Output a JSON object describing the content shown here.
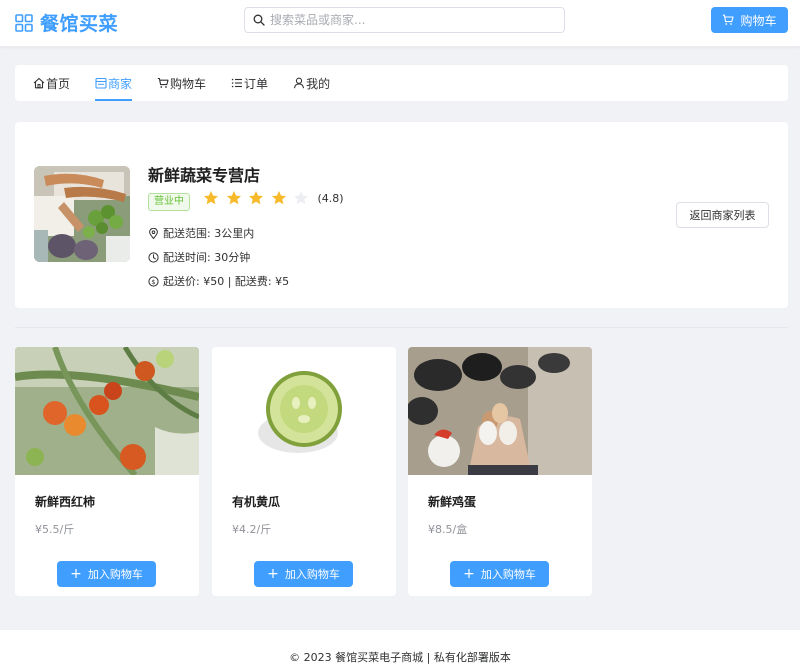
{
  "app": {
    "title": "餐馆买菜",
    "brand_color": "#409eff"
  },
  "header": {
    "search_placeholder": "搜索菜品或商家...",
    "cart_label": "购物车"
  },
  "nav": {
    "items": [
      {
        "label": "首页",
        "icon": "home-icon",
        "active": false
      },
      {
        "label": "商家",
        "icon": "shop-icon",
        "active": true
      },
      {
        "label": "购物车",
        "icon": "cart-icon",
        "active": false
      },
      {
        "label": "订单",
        "icon": "list-icon",
        "active": false
      },
      {
        "label": "我的",
        "icon": "user-icon",
        "active": false
      }
    ]
  },
  "store": {
    "name": "新鲜蔬菜专营店",
    "status": "营业中",
    "rating": 4.8,
    "rating_text": "(4.8)",
    "delivery_range": "配送范围: 3公里内",
    "delivery_time": "配送时间: 30分钟",
    "fees": "起送价: ¥50 | 配送费: ¥5",
    "back_label": "返回商家列表"
  },
  "products": [
    {
      "name": "新鲜西红柿",
      "price": "¥5.5/斤",
      "add_label": "加入购物车"
    },
    {
      "name": "有机黄瓜",
      "price": "¥4.2/斤",
      "add_label": "加入购物车"
    },
    {
      "name": "新鲜鸡蛋",
      "price": "¥8.5/盒",
      "add_label": "加入购物车"
    }
  ],
  "footer": {
    "text": "© 2023 餐馆买菜电子商城 | 私有化部署版本"
  }
}
